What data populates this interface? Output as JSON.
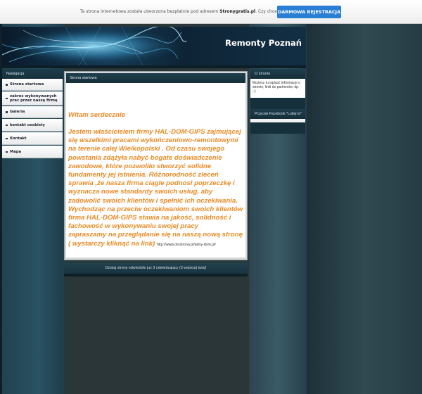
{
  "notice": {
    "text_before": "Ta strona internetowa została utworzona bezpłatnie pod adresem ",
    "brand": "Stronygratis.pl",
    "text_after": ". Czy chcesz też mieć własną stronę?",
    "button_label": "DARMOWA REJESTRACJA",
    "button_color": "#2a7fd4"
  },
  "header": {
    "site_title": "Remonty Poznań"
  },
  "nav": {
    "title": "Nawigacja",
    "items": [
      {
        "label": "Strona startowa"
      },
      {
        "label": "zakres wykonywanych prac przez naszą firmę"
      },
      {
        "label": "Galeria"
      },
      {
        "label": "kontakt osobisty"
      },
      {
        "label": "Kontakt"
      },
      {
        "label": "Mapa"
      }
    ]
  },
  "main": {
    "title": "Strona startowa",
    "welcome": "Witam serdecznie",
    "paragraph": "Jestem właścicielem firmy HAL-DOM-GIPS zajmującej się wszelkimi pracami wykończeniowo-remontowymi na terenie całej Wielkopolski . Od czasu swojego powstania zdążyła nabyć bogate doświadczenie zawodowe, które pozwoliło stworzyć solidne fundamenty jej istnienia. Różnorodność zleceń sprawia ,że nasza firma ciągle podnosi poprzeczkę i wyznacza nowe standardy swoich usług, aby zadowolić swoich klientów i spełnić ich oczekiwania. Wychodząc na przeciw oczekiwaniom swoich klientów firma HAL-DOM-GIPS stawia na jakość, solidność i fachowość w wykonywaniu swojej pracy",
    "invite": "zapraszamy na przeglądanie się na naszą  nową stronę ( wystarczy kliknąć na link)",
    "link": "http://www.otostrona.pl/adny-dom.pl/",
    "accent_color": "#e98a24"
  },
  "counter": {
    "text": "Dzisiaj stronę odwiedziło już 3 odwiedzający (3 wejścia) tutaj!"
  },
  "right": {
    "about_title": "O stronie",
    "about_text": "Możesz tu wpisać informacje o stronie, linki do partnerów, itp. ;-)",
    "facebook_title": "Przycisk Facebook \"Lubię to\""
  }
}
